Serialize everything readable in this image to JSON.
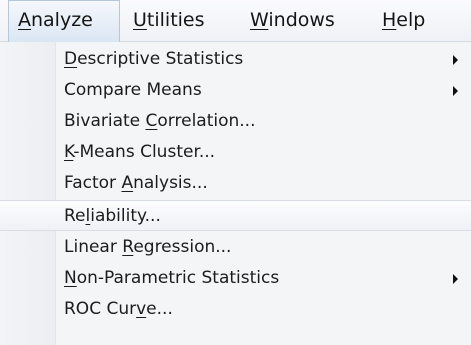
{
  "menubar": {
    "items": [
      {
        "pre": "",
        "u": "A",
        "post": "nalyze"
      },
      {
        "pre": "",
        "u": "U",
        "post": "tilities"
      },
      {
        "pre": "",
        "u": "W",
        "post": "indows"
      },
      {
        "pre": "",
        "u": "H",
        "post": "elp"
      }
    ]
  },
  "menu": {
    "items": [
      {
        "pre": "",
        "u": "D",
        "post": "escriptive Statistics",
        "submenu": true
      },
      {
        "pre": "Compare Means",
        "u": "",
        "post": "",
        "submenu": true
      },
      {
        "pre": "Bivariate ",
        "u": "C",
        "post": "orrelation...",
        "submenu": false
      },
      {
        "pre": "",
        "u": "K",
        "post": "-Means Cluster...",
        "submenu": false
      },
      {
        "pre": "Factor ",
        "u": "A",
        "post": "nalysis...",
        "submenu": false
      },
      {
        "pre": "Re",
        "u": "l",
        "post": "iability...",
        "submenu": false
      },
      {
        "pre": "Linear ",
        "u": "R",
        "post": "egression...",
        "submenu": false
      },
      {
        "pre": "",
        "u": "N",
        "post": "on-Parametric Statistics",
        "submenu": true
      },
      {
        "pre": "ROC Cur",
        "u": "v",
        "post": "e...",
        "submenu": false
      }
    ]
  }
}
